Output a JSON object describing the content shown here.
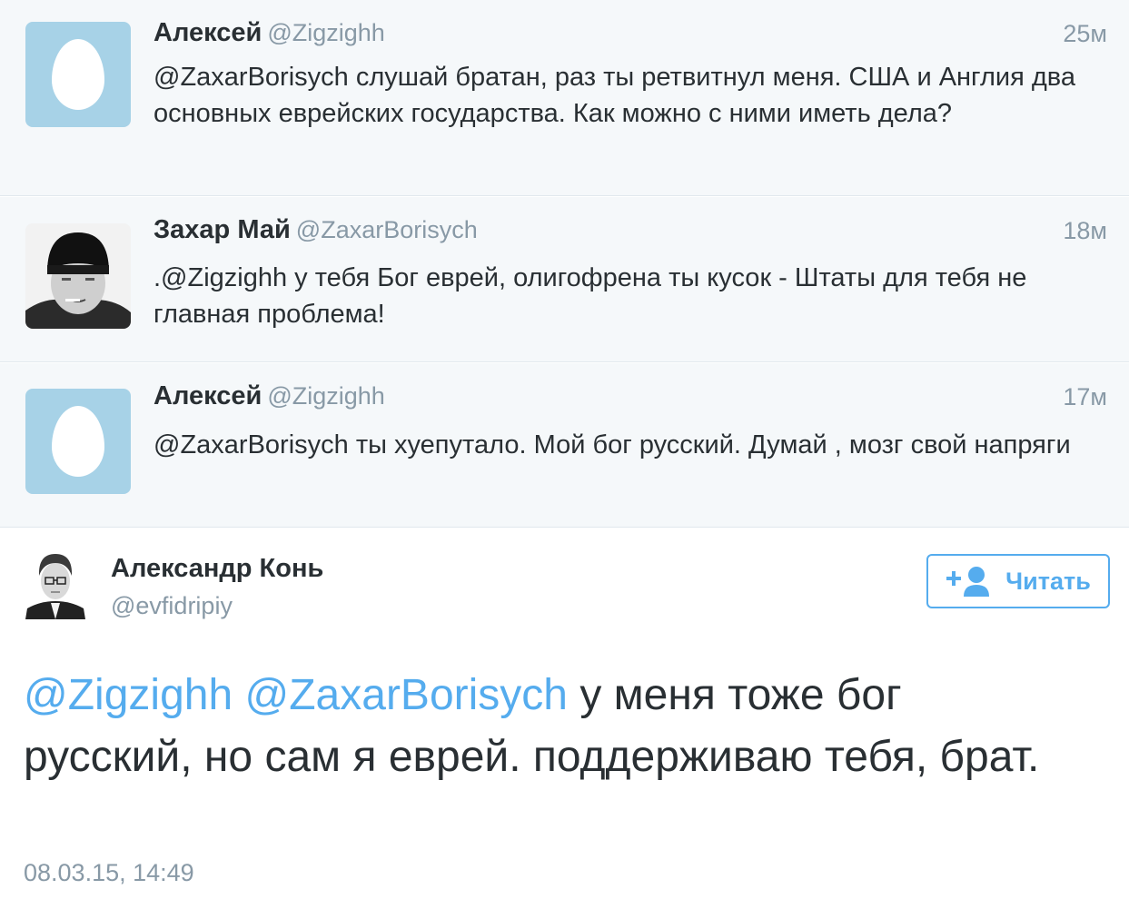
{
  "replies": [
    {
      "name": "Алексей",
      "handle": "@Zigzighh",
      "time": "25м",
      "text": "@ZaxarBorisych слушай братан, раз ты ретвитнул меня. США и Англия два основных еврейских государства.  Как можно с ними иметь дела?",
      "avatar": "default-egg"
    },
    {
      "name": "Захар Май",
      "handle": "@ZaxarBorisych",
      "time": "18м",
      "text": ".@Zigzighh  у тебя Бог еврей, олигофрена ты кусок - Штаты для тебя не главная проблема!",
      "avatar": "photo"
    },
    {
      "name": "Алексей",
      "handle": "@Zigzighh",
      "time": "17м",
      "text": "@ZaxarBorisych ты хуепутало.  Мой бог русский.  Думай , мозг свой напряги",
      "avatar": "default-egg"
    }
  ],
  "main": {
    "name": "Александр Конь",
    "handle": "@evfidripiy",
    "follow_label": "Читать",
    "mention1": "@Zigzighh",
    "mention2": "@ZaxarBorisych",
    "text_rest": " у меня тоже бог русский, но сам я еврей. поддерживаю тебя, брат.",
    "timestamp": "08.03.15, 14:49"
  },
  "colors": {
    "accent": "#55acee",
    "muted": "#8899a6",
    "text": "#292f33",
    "reply_bg": "#f5f8fa",
    "egg_bg": "#a7d2e7"
  }
}
